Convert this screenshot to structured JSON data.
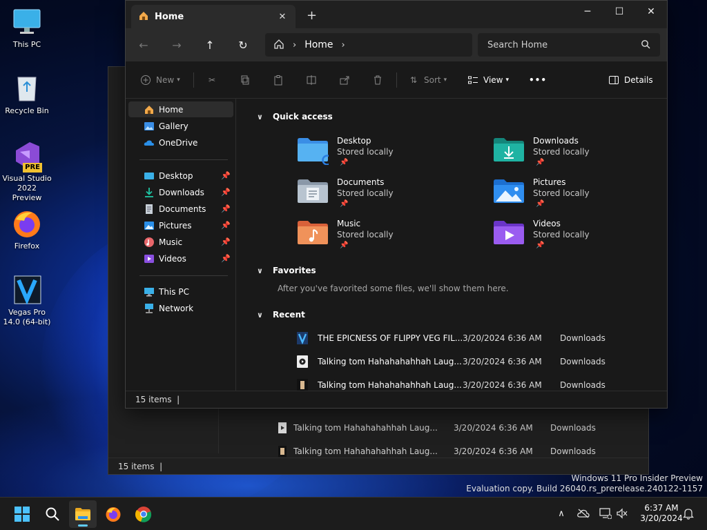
{
  "desktop": {
    "icons": [
      {
        "label": "This PC"
      },
      {
        "label": "Recycle Bin"
      },
      {
        "label": "Visual Studio 2022 Preview",
        "badge": "PRE"
      },
      {
        "label": "Firefox"
      },
      {
        "label": "Vegas Pro 14.0 (64-bit)"
      }
    ]
  },
  "back_window": {
    "rows": [
      {
        "name": "Talking tom Hahahahahhah Laug...",
        "date": "3/20/2024 6:36 AM",
        "location": "Downloads"
      },
      {
        "name": "Talking tom Hahahahahhah Laug...",
        "date": "3/20/2024 6:36 AM",
        "location": "Downloads"
      }
    ],
    "status": "15 items"
  },
  "explorer": {
    "tab_title": "Home",
    "address": {
      "crumb": "Home"
    },
    "search": {
      "placeholder": "Search Home"
    },
    "toolbar": {
      "new": "New",
      "sort": "Sort",
      "view": "View",
      "more": "•••",
      "details": "Details"
    },
    "nav": {
      "top": [
        {
          "label": "Home"
        },
        {
          "label": "Gallery"
        },
        {
          "label": "OneDrive"
        }
      ],
      "pinned": [
        {
          "label": "Desktop"
        },
        {
          "label": "Downloads"
        },
        {
          "label": "Documents"
        },
        {
          "label": "Pictures"
        },
        {
          "label": "Music"
        },
        {
          "label": "Videos"
        }
      ],
      "bottom": [
        {
          "label": "This PC"
        },
        {
          "label": "Network"
        }
      ]
    },
    "quick_access": {
      "title": "Quick access",
      "items": [
        {
          "name": "Desktop",
          "sub": "Stored locally"
        },
        {
          "name": "Downloads",
          "sub": "Stored locally"
        },
        {
          "name": "Documents",
          "sub": "Stored locally"
        },
        {
          "name": "Pictures",
          "sub": "Stored locally"
        },
        {
          "name": "Music",
          "sub": "Stored locally"
        },
        {
          "name": "Videos",
          "sub": "Stored locally"
        }
      ]
    },
    "favorites": {
      "title": "Favorites",
      "message": "After you've favorited some files, we'll show them here."
    },
    "recent": {
      "title": "Recent",
      "items": [
        {
          "name": "THE EPICNESS OF FLIPPY VEG FIL...",
          "date": "3/20/2024 6:36 AM",
          "location": "Downloads"
        },
        {
          "name": "Talking tom Hahahahahhah Laug...",
          "date": "3/20/2024 6:36 AM",
          "location": "Downloads"
        },
        {
          "name": "Talking tom Hahahahahhah Laug...",
          "date": "3/20/2024 6:36 AM",
          "location": "Downloads"
        }
      ]
    },
    "status": "15 items"
  },
  "watermark": {
    "line1": "Windows 11 Pro Insider Preview",
    "line2": "Evaluation copy. Build 26040.rs_prerelease.240122-1157"
  },
  "taskbar": {
    "clock": {
      "time": "6:37 AM",
      "date": "3/20/2024"
    }
  },
  "colors": {
    "accent": "#60cdff",
    "folder_blue": "#3a8ee6",
    "folder_teal": "#1fa89a",
    "folder_orange": "#e8894a",
    "folder_purple": "#8a4fe0"
  }
}
